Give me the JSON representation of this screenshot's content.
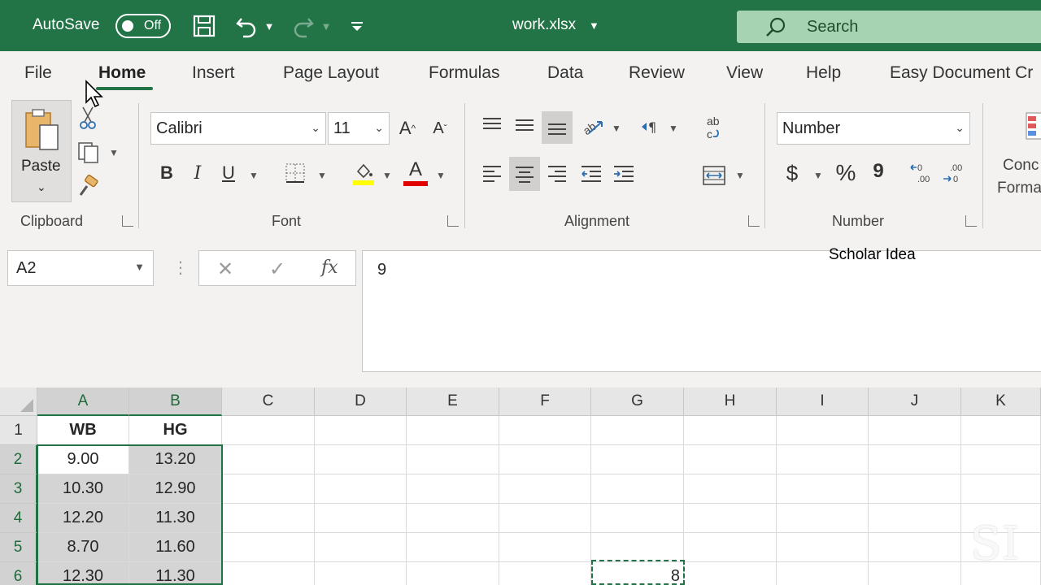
{
  "titlebar": {
    "autosave_label": "AutoSave",
    "autosave_state": "Off",
    "filename": "work.xlsx",
    "search_placeholder": "Search"
  },
  "tabs": [
    {
      "label": "File"
    },
    {
      "label": "Home"
    },
    {
      "label": "Insert"
    },
    {
      "label": "Page Layout"
    },
    {
      "label": "Formulas"
    },
    {
      "label": "Data"
    },
    {
      "label": "Review"
    },
    {
      "label": "View"
    },
    {
      "label": "Help"
    },
    {
      "label": "Easy Document Cr"
    }
  ],
  "ribbon": {
    "clipboard": {
      "label": "Clipboard",
      "paste_label": "Paste"
    },
    "font": {
      "label": "Font",
      "font_name": "Calibri",
      "font_size": "11",
      "bold": "B",
      "italic": "I",
      "underline": "U",
      "grow": "A",
      "shrink": "A",
      "font_color": "A"
    },
    "alignment": {
      "label": "Alignment"
    },
    "number": {
      "label": "Number",
      "format": "Number",
      "currency": "$",
      "percent": "%",
      "comma": "9"
    },
    "styles_partial": {
      "line1": "Conc",
      "line2": "Forma"
    }
  },
  "formula_bar": {
    "name_box": "A2",
    "value": "9",
    "fx": "fx"
  },
  "overlay_text": "Scholar Idea",
  "grid": {
    "columns": [
      "A",
      "B",
      "C",
      "D",
      "E",
      "F",
      "G",
      "H",
      "I",
      "J",
      "K"
    ],
    "rows": [
      "1",
      "2",
      "3",
      "4",
      "5",
      "6"
    ],
    "cells": {
      "A1": "WB",
      "B1": "HG",
      "A2": "9.00",
      "B2": "13.20",
      "A3": "10.30",
      "B3": "12.90",
      "A4": "12.20",
      "B4": "11.30",
      "A5": "8.70",
      "B5": "11.60",
      "A6": "12.30",
      "B6": "11.30",
      "G6": "8"
    }
  },
  "colors": {
    "accent": "#217346",
    "titlebar": "#227447",
    "search_bg": "#a6d4b2"
  }
}
